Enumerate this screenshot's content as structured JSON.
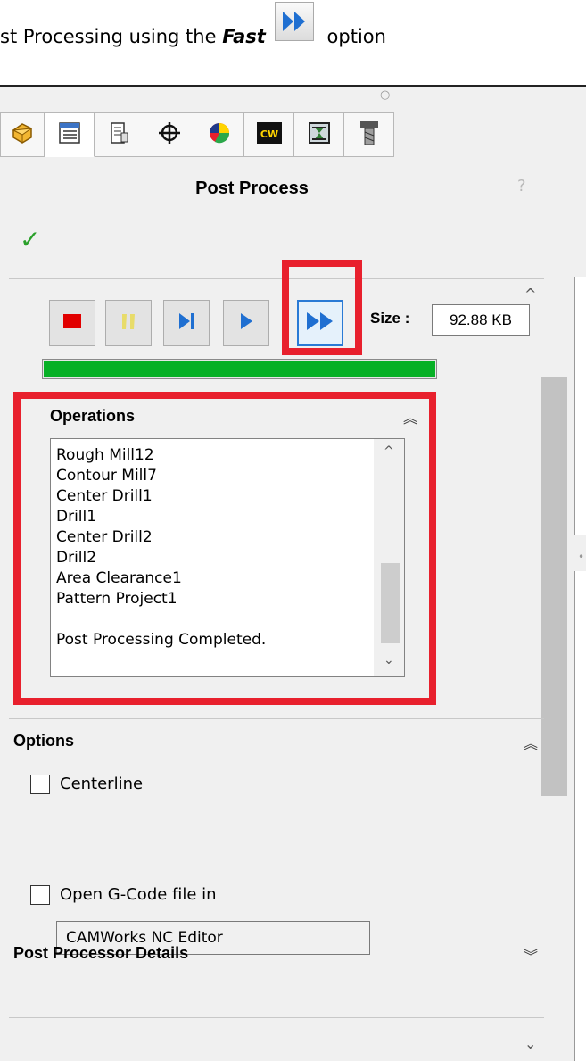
{
  "caption": {
    "prefix": "st Processing using the ",
    "fast": "Fast",
    "suffix": " option"
  },
  "icons": {
    "tabs": [
      "parts-icon",
      "feature-tree-icon",
      "property-manager-icon",
      "coordinate-icon",
      "appearance-icon",
      "camworks-icon",
      "simulation-icon",
      "tool-icon"
    ],
    "caption_icon": "fast-forward-icon"
  },
  "panel": {
    "title": "Post Process",
    "help": "?",
    "ok": "✓"
  },
  "controls": {
    "size_label": "Size :",
    "size_value": "92.88 KB",
    "progress_fraction": 1.0
  },
  "operations": {
    "title": "Operations",
    "collapse": "≈",
    "lines": [
      "Rough Mill12",
      "Contour Mill7",
      "Center Drill1",
      "Drill1",
      "Center Drill2",
      "Drill2",
      "Area Clearance1",
      "Pattern Project1",
      "",
      "Post Processing Completed."
    ]
  },
  "options": {
    "title": "Options",
    "centerline_label": "Centerline",
    "centerline_checked": false,
    "open_gcode_label": "Open G-Code file in",
    "open_gcode_checked": false,
    "editor": "CAMWorks NC Editor"
  },
  "post_processor_details": {
    "title": "Post Processor Details"
  },
  "colors": {
    "highlight": "#e8202d",
    "progress": "#06b025",
    "accent_blue": "#2a7ad5",
    "ok_green": "#2aa02a"
  }
}
